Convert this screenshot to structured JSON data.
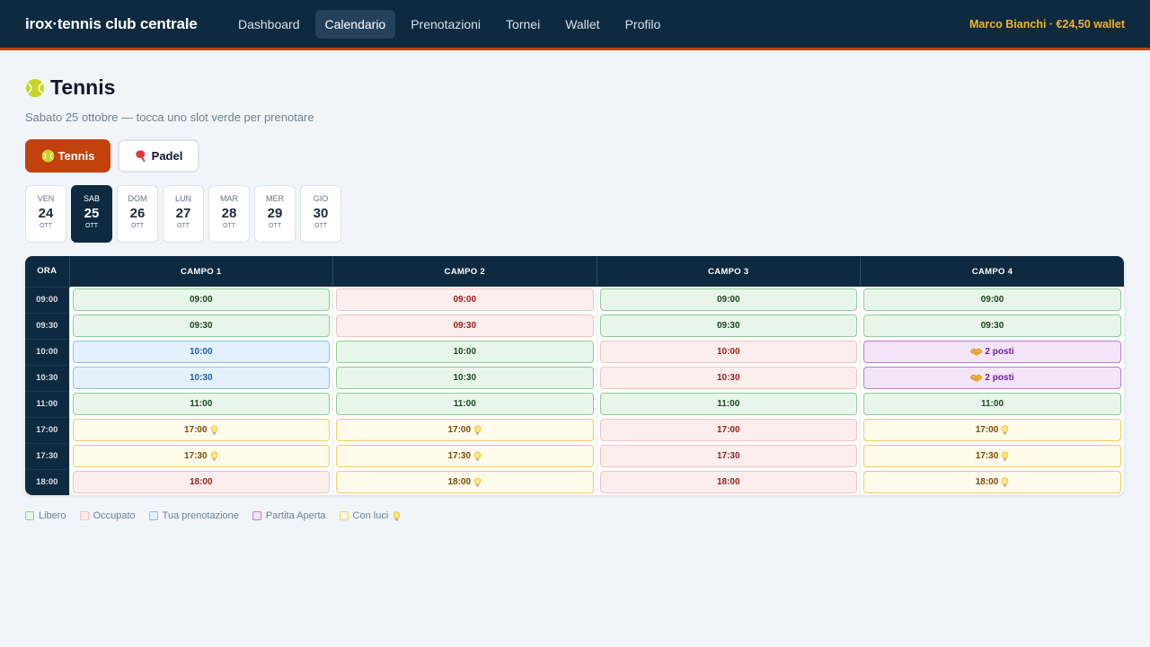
{
  "header": {
    "brand": "irox·tennis club centrale",
    "nav": [
      "Dashboard",
      "Calendario",
      "Prenotazioni",
      "Tornei",
      "Wallet",
      "Profilo"
    ],
    "active_nav": "Calendario",
    "user": "Marco Bianchi · €24,50 wallet"
  },
  "page": {
    "title": "Tennis",
    "subtitle": "Sabato 25 ottobre — tocca uno slot verde per prenotare"
  },
  "sports": [
    {
      "label": "Tennis",
      "icon": "tennis-ball-icon",
      "active": true
    },
    {
      "label": "Padel",
      "icon": "padel-racket-icon",
      "active": false
    }
  ],
  "days": [
    {
      "dow": "VEN",
      "num": "24",
      "mon": "OTT",
      "active": false
    },
    {
      "dow": "SAB",
      "num": "25",
      "mon": "OTT",
      "active": true
    },
    {
      "dow": "DOM",
      "num": "26",
      "mon": "OTT",
      "active": false
    },
    {
      "dow": "LUN",
      "num": "27",
      "mon": "OTT",
      "active": false
    },
    {
      "dow": "MAR",
      "num": "28",
      "mon": "OTT",
      "active": false
    },
    {
      "dow": "MER",
      "num": "29",
      "mon": "OTT",
      "active": false
    },
    {
      "dow": "GIO",
      "num": "30",
      "mon": "OTT",
      "active": false
    }
  ],
  "schedule": {
    "ora_header": "ORA",
    "courts": [
      "CAMPO 1",
      "CAMPO 2",
      "CAMPO 3",
      "CAMPO 4"
    ],
    "rows": [
      {
        "time": "09:00",
        "slots": [
          {
            "label": "09:00",
            "status": "free"
          },
          {
            "label": "09:00",
            "status": "busy"
          },
          {
            "label": "09:00",
            "status": "free"
          },
          {
            "label": "09:00",
            "status": "free"
          }
        ]
      },
      {
        "time": "09:30",
        "slots": [
          {
            "label": "09:30",
            "status": "free"
          },
          {
            "label": "09:30",
            "status": "busy"
          },
          {
            "label": "09:30",
            "status": "free"
          },
          {
            "label": "09:30",
            "status": "free"
          }
        ]
      },
      {
        "time": "10:00",
        "slots": [
          {
            "label": "10:00",
            "status": "mine"
          },
          {
            "label": "10:00",
            "status": "free"
          },
          {
            "label": "10:00",
            "status": "busy"
          },
          {
            "label": "2 posti",
            "status": "open"
          }
        ]
      },
      {
        "time": "10:30",
        "slots": [
          {
            "label": "10:30",
            "status": "mine"
          },
          {
            "label": "10:30",
            "status": "free"
          },
          {
            "label": "10:30",
            "status": "busy"
          },
          {
            "label": "2 posti",
            "status": "open"
          }
        ]
      },
      {
        "time": "11:00",
        "slots": [
          {
            "label": "11:00",
            "status": "free"
          },
          {
            "label": "11:00",
            "status": "free"
          },
          {
            "label": "11:00",
            "status": "free"
          },
          {
            "label": "11:00",
            "status": "free"
          }
        ]
      },
      {
        "time": "17:00",
        "slots": [
          {
            "label": "17:00",
            "status": "light"
          },
          {
            "label": "17:00",
            "status": "light"
          },
          {
            "label": "17:00",
            "status": "busy"
          },
          {
            "label": "17:00",
            "status": "light"
          }
        ]
      },
      {
        "time": "17:30",
        "slots": [
          {
            "label": "17:30",
            "status": "light"
          },
          {
            "label": "17:30",
            "status": "light"
          },
          {
            "label": "17:30",
            "status": "busy"
          },
          {
            "label": "17:30",
            "status": "light"
          }
        ]
      },
      {
        "time": "18:00",
        "slots": [
          {
            "label": "18:00",
            "status": "busy"
          },
          {
            "label": "18:00",
            "status": "light"
          },
          {
            "label": "18:00",
            "status": "busy"
          },
          {
            "label": "18:00",
            "status": "light"
          }
        ]
      }
    ]
  },
  "legend": [
    {
      "label": "Libero",
      "status": "free"
    },
    {
      "label": "Occupato",
      "status": "busy"
    },
    {
      "label": "Tua prenotazione",
      "status": "mine"
    },
    {
      "label": "Partita Aperta",
      "status": "open"
    },
    {
      "label": "Con luci",
      "status": "light"
    }
  ],
  "colors": {
    "header_bg": "#0e2a40",
    "accent": "#c2410c",
    "wallet": "#f5b31f"
  }
}
